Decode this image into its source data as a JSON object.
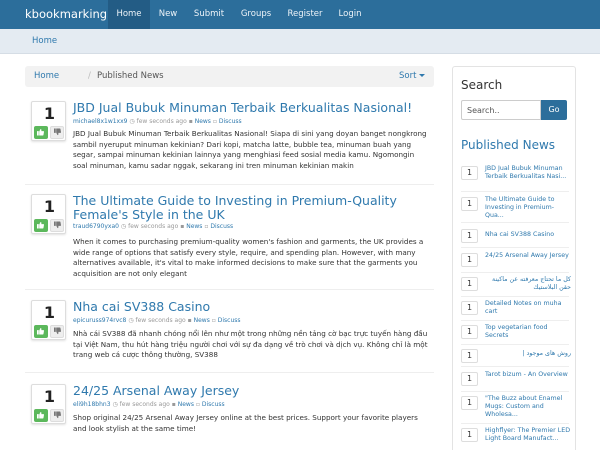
{
  "nav": {
    "brand": "kbookmarking",
    "items": [
      {
        "label": "Home",
        "active": true
      },
      {
        "label": "New"
      },
      {
        "label": "Submit"
      },
      {
        "label": "Groups"
      },
      {
        "label": "Register"
      },
      {
        "label": "Login"
      }
    ]
  },
  "crumb_bar": {
    "home": "Home"
  },
  "breadcrumb": {
    "home": "Home",
    "separator": "/",
    "current": "Published News",
    "sort": "Sort"
  },
  "stories": [
    {
      "votes": "1",
      "title": "JBD Jual Bubuk Minuman Terbaik Berkualitas Nasional!",
      "user": "michael8x1w1xx9",
      "time": "few seconds ago",
      "category": "News",
      "discuss": "Discuss",
      "body": "JBD Jual Bubuk Minuman Terbaik Berkualitas Nasional! Siapa di sini yang doyan banget nongkrong sambil nyeruput minuman kekinian? Dari kopi, matcha latte, bubble tea, minuman buah yang segar, sampai minuman kekinian lainnya yang menghiasi feed sosial media kamu. Ngomongin soal minuman, kamu sadar nggak, sekarang ini tren minuman kekinian makin"
    },
    {
      "votes": "1",
      "title": "The Ultimate Guide to Investing in Premium-Quality Female's Style in the UK",
      "user": "traud6790yxa0",
      "time": "few seconds ago",
      "category": "News",
      "discuss": "Discuss",
      "body": "When it comes to purchasing premium-quality women's fashion and garments, the UK provides a wide range of options that satisfy every style, require, and spending plan. However, with many alternatives available, it's vital to make informed decisions to make sure that the garments you acquisition are not only elegant"
    },
    {
      "votes": "1",
      "title": "Nha cai SV388 Casino",
      "user": "epicuruss974rvc8",
      "time": "few seconds ago",
      "category": "News",
      "discuss": "Discuss",
      "body": "Nhà cái SV388 đã nhanh chóng nổi lên như một trong những nền tảng cờ bạc trực tuyến hàng đầu tại Việt Nam, thu hút hàng triệu người chơi với sự đa dạng về trò chơi và dịch vụ. Không chỉ là một trang web cá cược thông thường, SV388"
    },
    {
      "votes": "1",
      "title": "24/25 Arsenal Away Jersey",
      "user": "eli9h18bhn3",
      "time": "few seconds ago",
      "category": "News",
      "discuss": "Discuss",
      "body": "Shop original 24/25 Arsenal Away Jersey online at the best prices. Support your favorite players and look stylish at the same time!"
    }
  ],
  "sidebar": {
    "search_heading": "Search",
    "search_placeholder": "Search..",
    "go_label": "Go",
    "published_heading": "Published News",
    "items": [
      {
        "count": "1",
        "title": "JBD Jual Bubuk Minuman Terbaik Berkualitas Nasi..."
      },
      {
        "count": "1",
        "title": "The Ultimate Guide to Investing in Premium-Qua..."
      },
      {
        "count": "1",
        "title": "Nha cai SV388 Casino"
      },
      {
        "count": "1",
        "title": "24/25 Arsenal Away Jersey"
      },
      {
        "count": "1",
        "title": "كل ما تحتاج معرفته عن ماكينة حقن البلاستيك"
      },
      {
        "count": "1",
        "title": "Detailed Notes on muha cart"
      },
      {
        "count": "1",
        "title": "Top vegetarian food Secrets"
      },
      {
        "count": "1",
        "title": "روش های موجود |"
      },
      {
        "count": "1",
        "title": "Tarot bizum - An Overview"
      },
      {
        "count": "1",
        "title": "\"The Buzz about Enamel Mugs: Custom and Wholesa..."
      },
      {
        "count": "1",
        "title": "Highflyer: The Premier LED Light Board Manufact..."
      }
    ]
  },
  "colors": {
    "brand": "#2c6e9b",
    "link": "#2f79ad",
    "vote_up": "#5cb85c"
  }
}
